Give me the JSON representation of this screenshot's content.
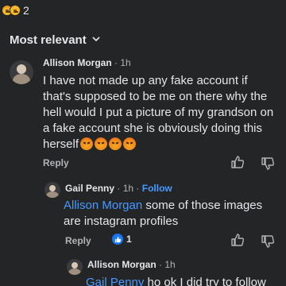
{
  "top_reactions": {
    "count": "2"
  },
  "sort": {
    "label": "Most relevant",
    "chevron": "chevron-down-icon"
  },
  "comments": [
    {
      "author": "Allison Morgan",
      "time": "1h",
      "text": "I have not made up any fake account if that's supposed to be me on there why the hell would I put a picture of my grandson on a fake account she is obviously doing this herself",
      "reply_label": "Reply"
    },
    {
      "author": "Gail Penny",
      "time": "1h",
      "follow_label": "Follow",
      "mention": "Allison Morgan",
      "text": " some of those images are instagram profiles",
      "reply_label": "Reply",
      "like_count": "1"
    },
    {
      "author": "Allison Morgan",
      "time": "1h",
      "mention": "Gail Penny",
      "text": " ho ok I did try to follow"
    }
  ],
  "colors": {
    "background": "#242526",
    "text": "#e4e6eb",
    "secondary": "#b0b3b8",
    "link": "#4599ff",
    "like": "#1877f2"
  }
}
